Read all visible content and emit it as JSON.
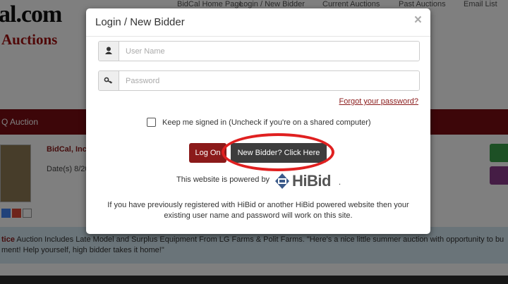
{
  "background": {
    "logo_line1": "al.com",
    "logo_line2": "Auctions",
    "nav": [
      "BidCal Home Page",
      "Login / New Bidder",
      "Current Auctions",
      "Past Auctions",
      "Email List"
    ],
    "banner_text": "Q Auction",
    "bidder_name": "BidCal, Inc.",
    "dates": "Date(s) 8/20",
    "notice_lead": "tice",
    "notice_line1": " Auction Includes Late Model and Surplus Equipment From LG Farms & Polit Farms. \"Here's a nice little summer auction with opportunity to bu",
    "notice_line2": "ment! Help yourself, high bidder takes it home!\""
  },
  "modal": {
    "title": "Login / New Bidder",
    "close_label": "×",
    "username_placeholder": "User Name",
    "password_placeholder": "Password",
    "forgot_link": "Forgot your password?",
    "keep_signed_in": "Keep me signed in (Uncheck if you're on a shared computer)",
    "logon_button": "Log On",
    "new_bidder_button": "New Bidder? Click Here",
    "powered_by": "This website is powered by",
    "powered_brand": "HiBid",
    "powered_period": ".",
    "info_text": "If you have previously registered with HiBid or another HiBid powered website then your existing user name and password will work on this site."
  },
  "colors": {
    "accent_red": "#8b1a1a",
    "annotation_ring": "#e02020",
    "dark_button": "#3d3d3d"
  }
}
